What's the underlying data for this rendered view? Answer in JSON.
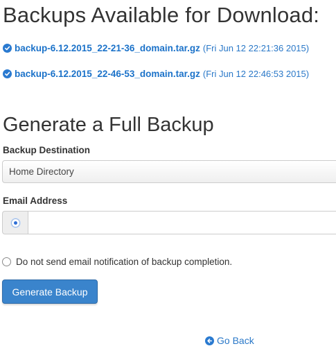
{
  "backups_section": {
    "title": "Backups Available for Download:",
    "items": [
      {
        "filename": "backup-6.12.2015_22-21-36_domain.tar.gz",
        "date": "(Fri Jun 12 22:21:36 2015)"
      },
      {
        "filename": "backup-6.12.2015_22-46-53_domain.tar.gz",
        "date": "(Fri Jun 12 22:46:53 2015)"
      }
    ],
    "icon": "check-circle-icon"
  },
  "generate_section": {
    "title": "Generate a Full Backup",
    "destination_label": "Backup Destination",
    "destination_value": "Home Directory",
    "email_label": "Email Address",
    "email_value": "",
    "email_placeholder": "",
    "no_email_label": "Do not send email notification of backup completion.",
    "submit_label": "Generate Backup"
  },
  "footer": {
    "go_back_label": "Go Back",
    "go_back_icon": "arrow-left-circle-icon"
  },
  "colors": {
    "link": "#1b72c9",
    "button": "#3a84cc",
    "text": "#333333"
  }
}
